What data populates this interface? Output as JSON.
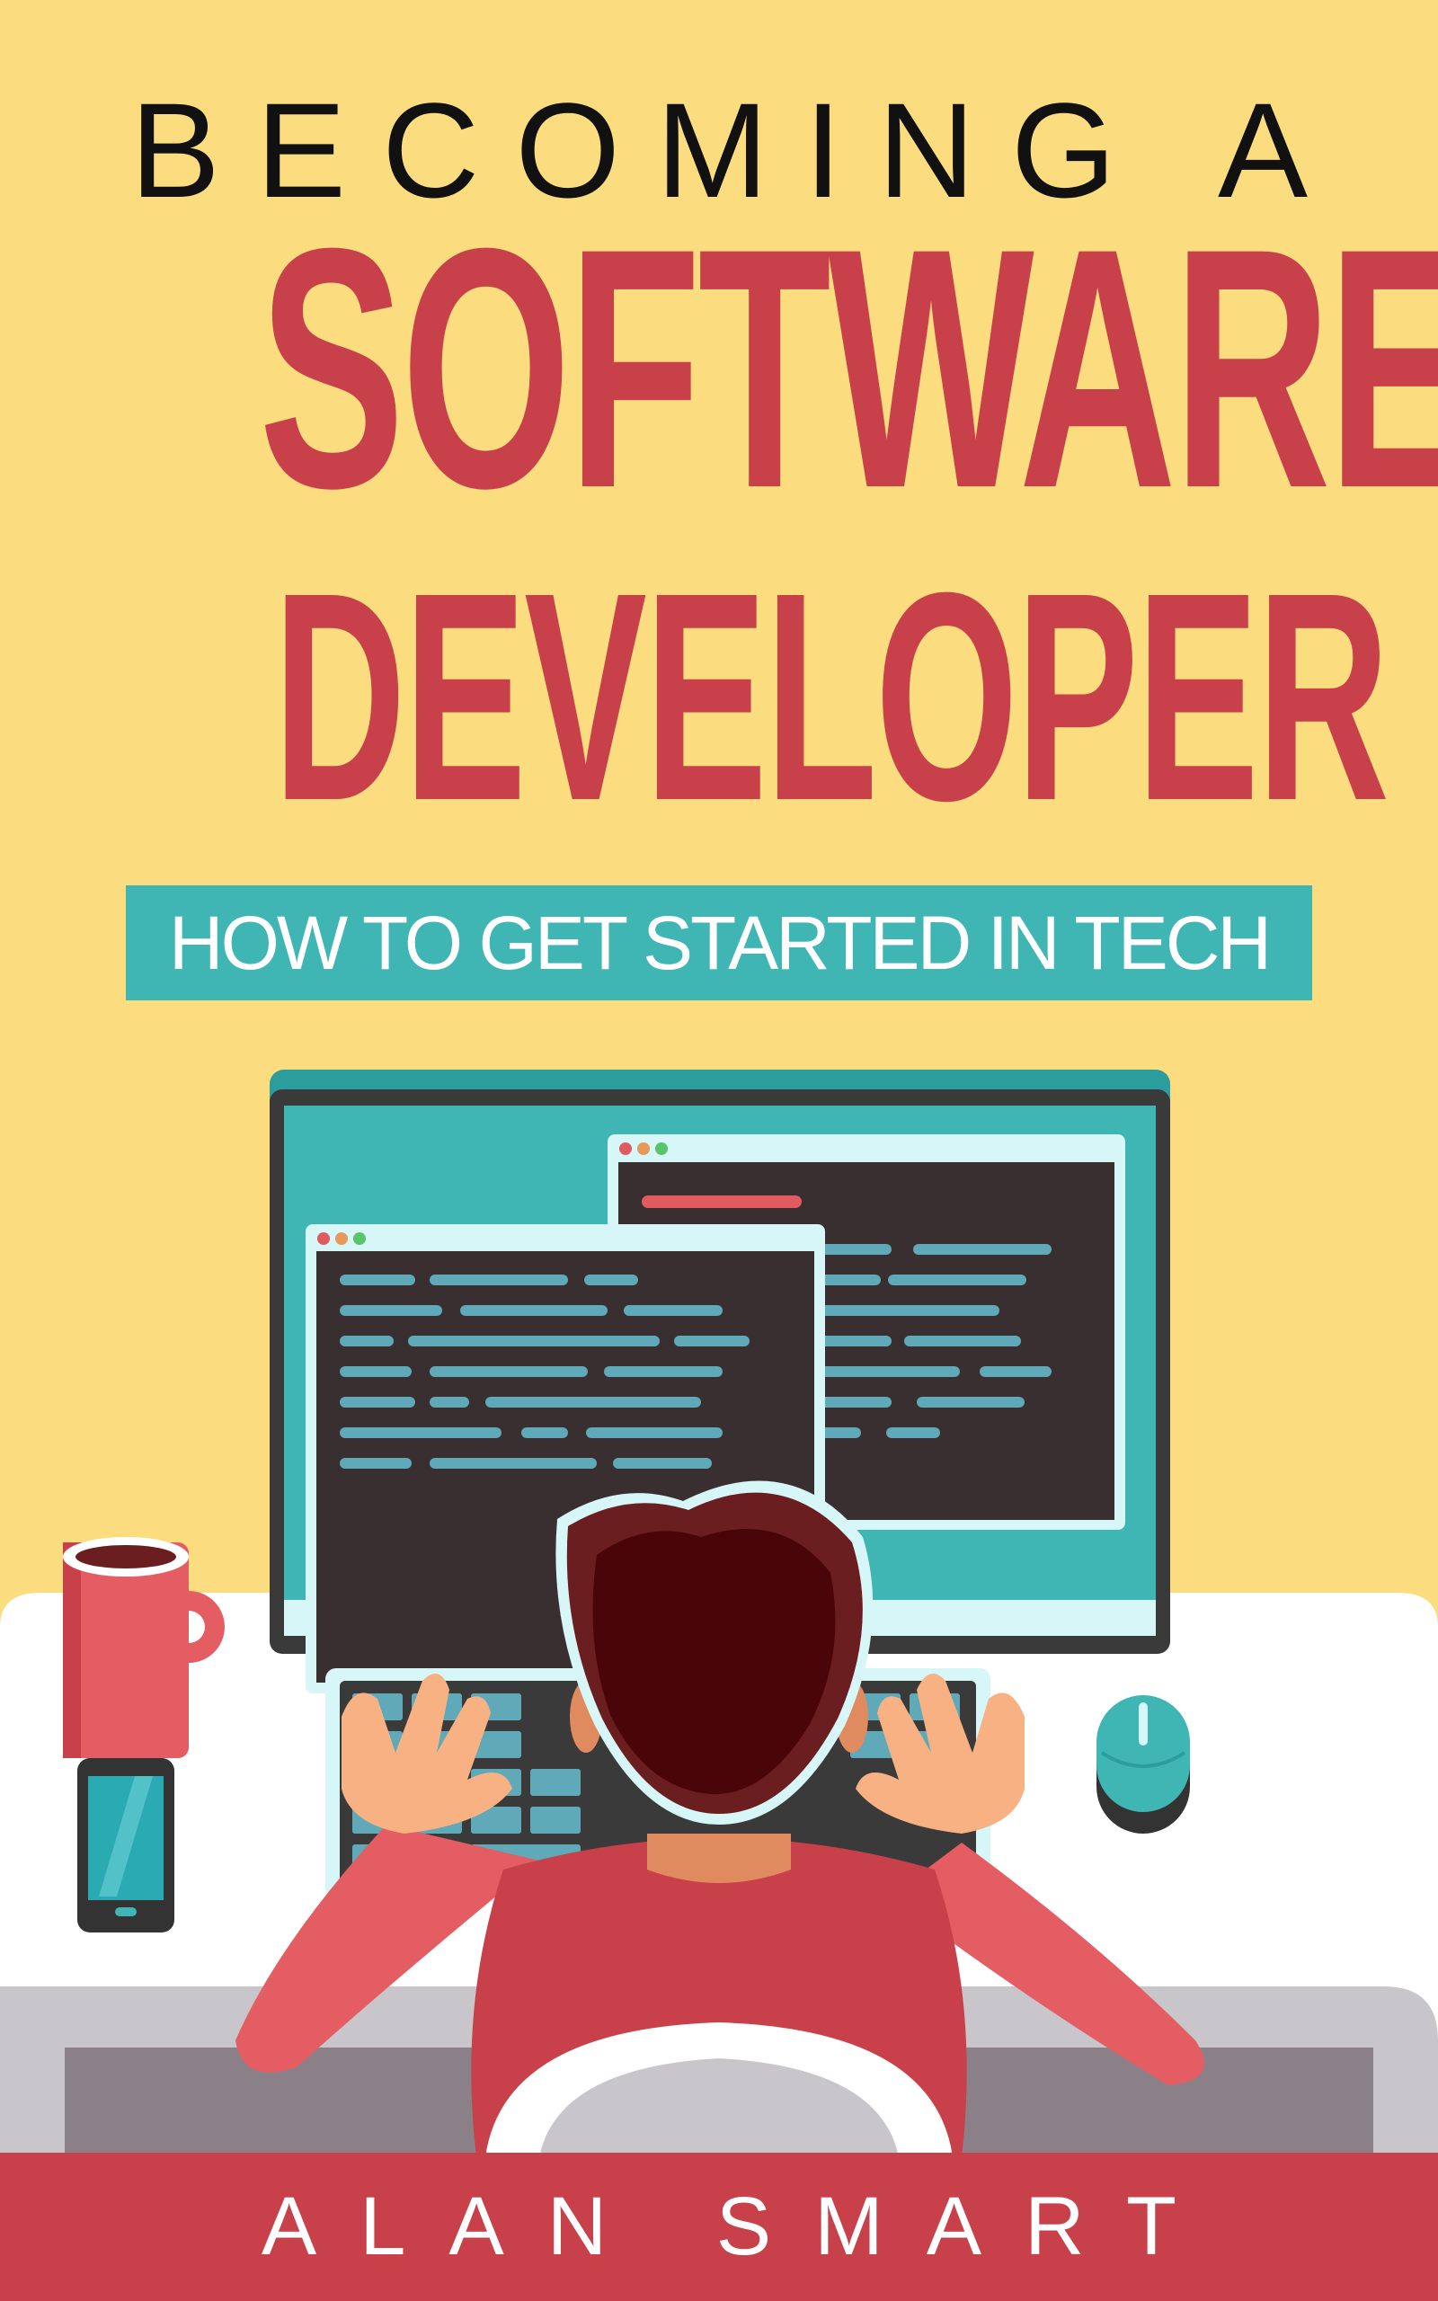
{
  "cover": {
    "pre_title": "BECOMING A",
    "title_line1": "SOFTWARE",
    "title_line2": "DEVELOPER",
    "subtitle": "HOW TO GET STARTED IN TECH",
    "author": "ALAN SMART"
  },
  "illustration": {
    "subject": "developer-at-computer",
    "icons": [
      "monitor-icon",
      "code-window-icon",
      "coffee-mug-icon",
      "smartphone-icon",
      "keyboard-icon",
      "mouse-icon",
      "person-icon",
      "chair-icon"
    ]
  },
  "colors": {
    "background": "#fbdc7e",
    "title": "#c8404a",
    "accent": "#3fb5b4",
    "author_bar": "#c8404a"
  }
}
